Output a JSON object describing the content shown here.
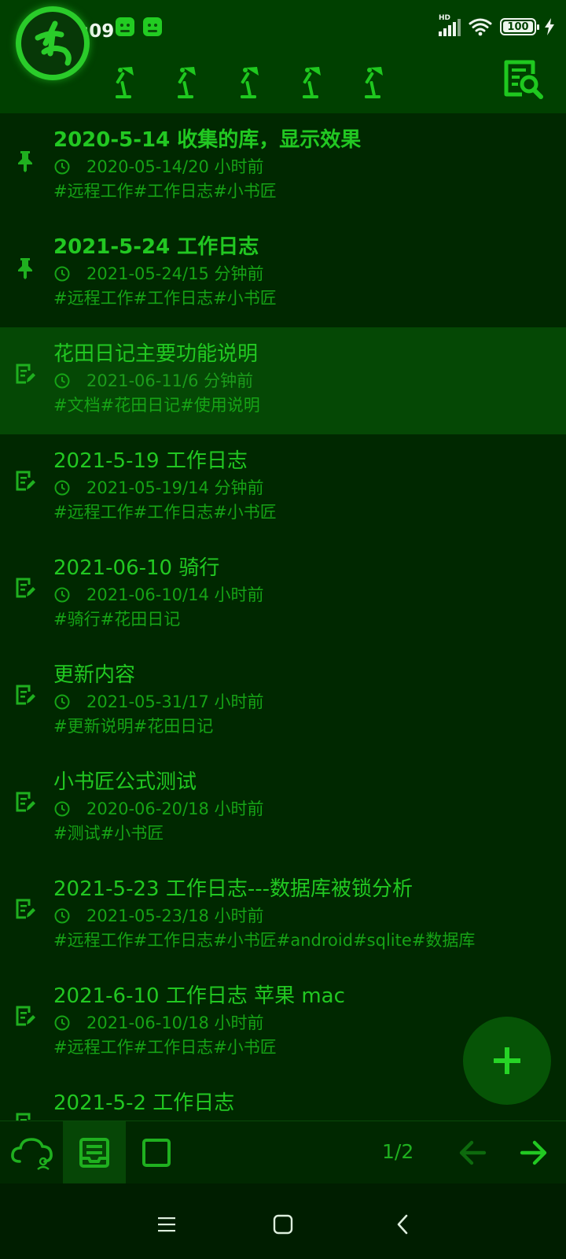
{
  "status_bar": {
    "time": "上午9:09",
    "network_label": "HD",
    "battery_level": "100",
    "app_icons": [
      "app-notification-icon",
      "app-notification-icon"
    ]
  },
  "toolbar": {
    "logo": "app-logo-icon",
    "lamp_icons": [
      "desk-lamp-icon",
      "desk-lamp-icon",
      "desk-lamp-icon",
      "desk-lamp-icon",
      "desk-lamp-icon"
    ],
    "search_icon": "document-search-icon"
  },
  "notes": [
    {
      "title": "2020-5-14 收集的库，显示效果",
      "time": "2020-05-14/20 小时前",
      "tags": "#远程工作#工作日志#小书匠",
      "pinned": true
    },
    {
      "title": "2021-5-24 工作日志",
      "time": "2021-05-24/15 分钟前",
      "tags": "#远程工作#工作日志#小书匠",
      "pinned": true
    },
    {
      "title": "花田日记主要功能说明",
      "time": "2021-06-11/6 分钟前",
      "tags": "#文档#花田日记#使用说明",
      "pinned": false,
      "selected": true
    },
    {
      "title": "2021-5-19 工作日志",
      "time": "2021-05-19/14 分钟前",
      "tags": "#远程工作#工作日志#小书匠",
      "pinned": false
    },
    {
      "title": "2021-06-10 骑行",
      "time": "2021-06-10/14 小时前",
      "tags": "#骑行#花田日记",
      "pinned": false
    },
    {
      "title": "更新内容",
      "time": "2021-05-31/17 小时前",
      "tags": "#更新说明#花田日记",
      "pinned": false
    },
    {
      "title": "小书匠公式测试",
      "time": "2020-06-20/18 小时前",
      "tags": "#测试#小书匠",
      "pinned": false
    },
    {
      "title": "2021-5-23 工作日志---数据库被锁分析",
      "time": "2021-05-23/18 小时前",
      "tags": "#远程工作#工作日志#小书匠#android#sqlite#数据库",
      "pinned": false
    },
    {
      "title": "2021-6-10 工作日志 苹果 mac",
      "time": "2021-06-10/18 小时前",
      "tags": "#远程工作#工作日志#小书匠",
      "pinned": false
    },
    {
      "title": "2021-5-2 工作日志",
      "time": "",
      "tags": "",
      "pinned": false
    }
  ],
  "fab": {
    "icon": "add-icon"
  },
  "bottom_bar": {
    "page_counter": "1/2",
    "icons": [
      "cloud-sync-icon",
      "notes-inbox-icon",
      "square-icon",
      "arrow-left-icon",
      "arrow-right-icon"
    ]
  },
  "colors": {
    "background": "#002800",
    "header": "#004000",
    "accent": "#22c822",
    "selected_row": "#054805"
  }
}
